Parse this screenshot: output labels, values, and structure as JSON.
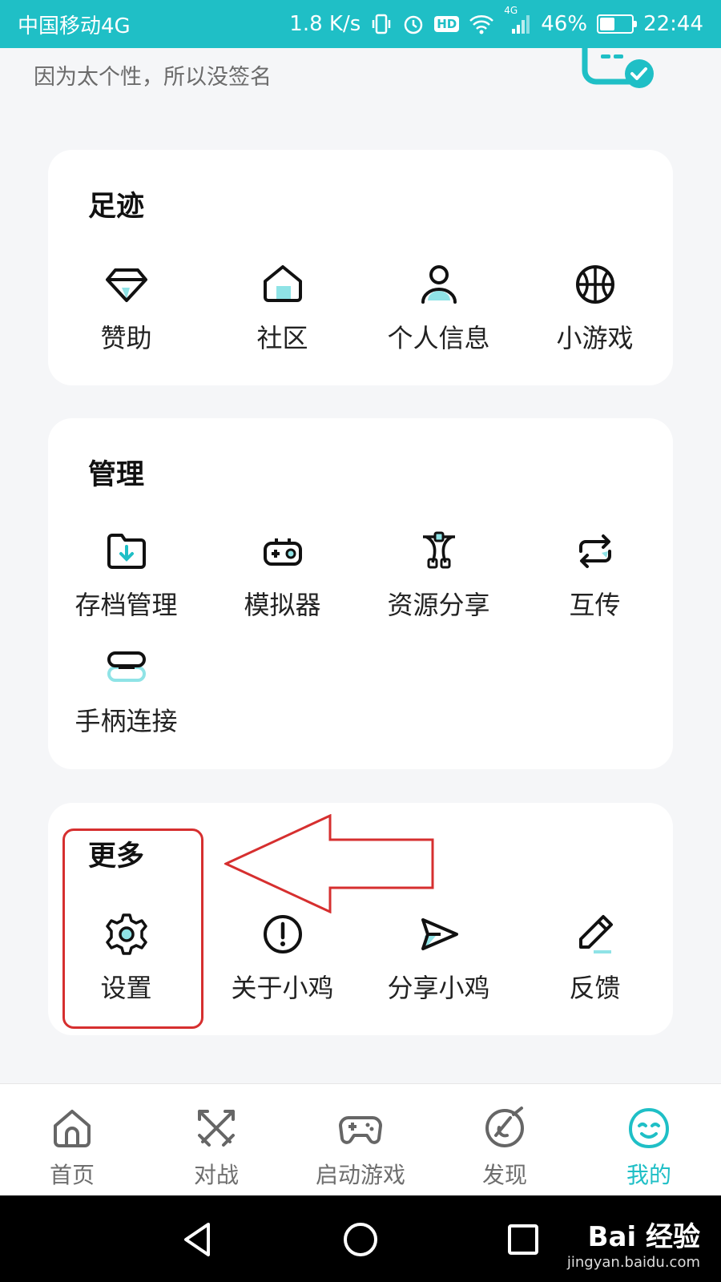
{
  "status_bar": {
    "carrier": "中国移动4G",
    "speed": "1.8 K/s",
    "hd": "HD",
    "battery": "46%",
    "battery_level": 0.46,
    "time": "22:44",
    "network": "4G"
  },
  "profile": {
    "signature": "因为太个性，所以没签名"
  },
  "sections": {
    "footprint": {
      "title": "足迹",
      "items": [
        {
          "label": "赞助",
          "icon": "diamond-icon"
        },
        {
          "label": "社区",
          "icon": "home-icon"
        },
        {
          "label": "个人信息",
          "icon": "person-icon"
        },
        {
          "label": "小游戏",
          "icon": "basketball-icon"
        }
      ]
    },
    "manage": {
      "title": "管理",
      "items": [
        {
          "label": "存档管理",
          "icon": "folder-download-icon"
        },
        {
          "label": "模拟器",
          "icon": "gamepad-icon"
        },
        {
          "label": "资源分享",
          "icon": "share-nodes-icon"
        },
        {
          "label": "互传",
          "icon": "sync-icon"
        },
        {
          "label": "手柄连接",
          "icon": "link-icon"
        }
      ]
    },
    "more": {
      "title": "更多",
      "items": [
        {
          "label": "设置",
          "icon": "gear-icon"
        },
        {
          "label": "关于小鸡",
          "icon": "info-icon"
        },
        {
          "label": "分享小鸡",
          "icon": "send-icon"
        },
        {
          "label": "反馈",
          "icon": "pencil-icon"
        }
      ]
    }
  },
  "bottom_nav": [
    {
      "label": "首页",
      "icon": "home-icon"
    },
    {
      "label": "对战",
      "icon": "swords-icon"
    },
    {
      "label": "启动游戏",
      "icon": "gamepad-icon"
    },
    {
      "label": "发现",
      "icon": "compass-icon"
    },
    {
      "label": "我的",
      "icon": "smiley-icon",
      "active": true
    }
  ],
  "watermark": {
    "brand": "Bai 经验",
    "url": "jingyan.baidu.com"
  },
  "colors": {
    "accent": "#1fbfc6",
    "annotation": "#d62f2f"
  }
}
